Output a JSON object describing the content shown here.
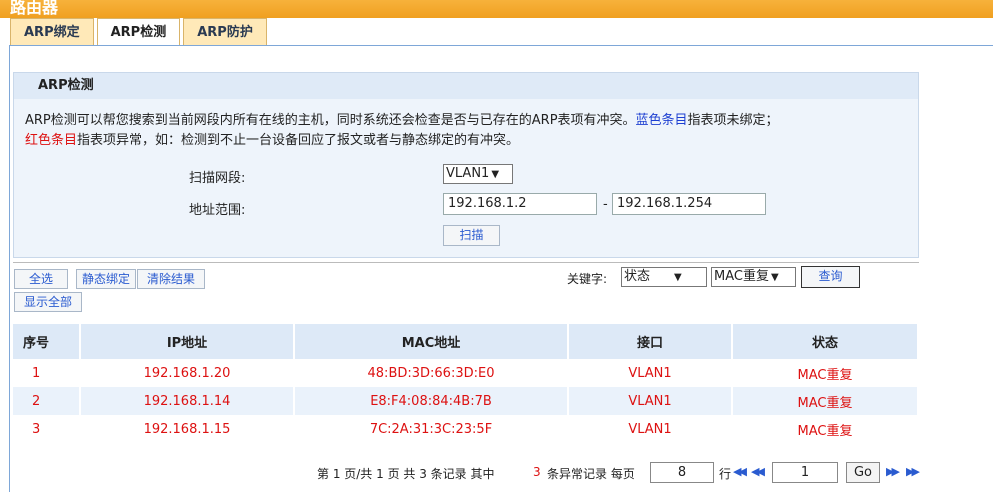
{
  "app": {
    "brand": "路由器"
  },
  "tabs": [
    {
      "label": "ARP绑定"
    },
    {
      "label": "ARP检测"
    },
    {
      "label": "ARP防护"
    }
  ],
  "panel": {
    "title": "ARP检测",
    "desc_main": "ARP检测可以帮您搜索到当前网段内所有在线的主机，同时系统还会检查是否与已存在的ARP表项有冲突。",
    "desc_blue": "蓝色条目",
    "desc_blue_tail": "指表项未绑定；",
    "desc_red": "红色条目",
    "desc_red_tail": "指表项异常，如：检测到不止一台设备回应了报文或者与静态绑定的有冲突。",
    "scan_segment_label": "扫描网段:",
    "scan_segment_value": "VLAN1",
    "range_label": "地址范围:",
    "range_start": "192.168.1.2",
    "range_sep": "-",
    "range_end": "192.168.1.254",
    "scan_button": "扫描"
  },
  "toolbar": {
    "select_all": "全选",
    "static_bind": "静态绑定",
    "clear_results": "清除结果",
    "show_all": "显示全部",
    "keyword_label": "关键字:",
    "keyword_field": "状态",
    "keyword_value": "MAC重复",
    "query_button": "查询"
  },
  "table": {
    "headers": [
      "序号",
      "IP地址",
      "MAC地址",
      "接口",
      "状态"
    ],
    "rows": [
      {
        "no": "1",
        "ip": "192.168.1.20",
        "mac": "48:BD:3D:66:3D:E0",
        "iface": "VLAN1",
        "status": "MAC重复"
      },
      {
        "no": "2",
        "ip": "192.168.1.14",
        "mac": "E8:F4:08:84:4B:7B",
        "iface": "VLAN1",
        "status": "MAC重复"
      },
      {
        "no": "3",
        "ip": "192.168.1.15",
        "mac": "7C:2A:31:3C:23:5F",
        "iface": "VLAN1",
        "status": "MAC重复"
      }
    ]
  },
  "pager": {
    "summary_prefix": "第 1 页/共 1 页 共 3 条记录 其中",
    "abnormal_count": "3",
    "summary_suffix": "条异常记录 每页",
    "per_page": "8",
    "rows_label": "行",
    "page_input": "1",
    "go_button": "Go"
  },
  "colors": {
    "accent_orange": "#f0a020",
    "abnormal_red": "#d11111",
    "header_blue": "#dde9f7"
  }
}
